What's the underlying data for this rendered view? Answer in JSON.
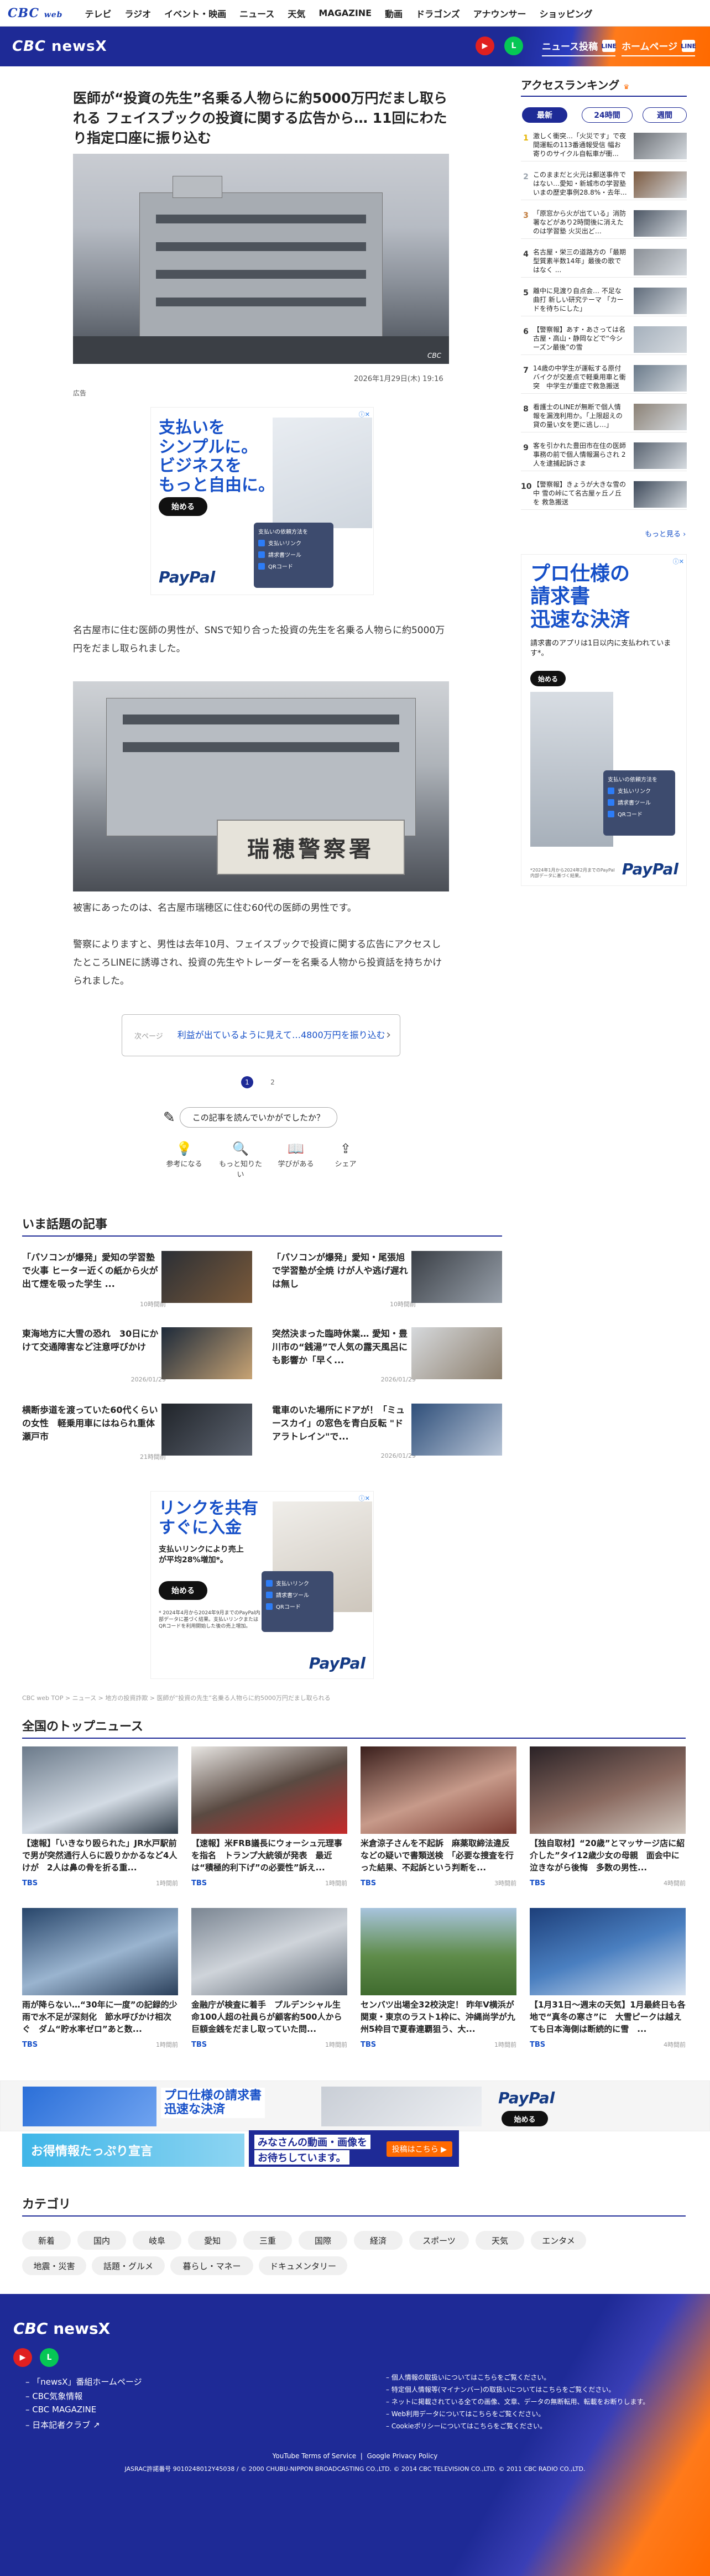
{
  "nav": {
    "logo": "CBC",
    "logo_sub": "web",
    "items": [
      "テレビ",
      "ラジオ",
      "イベント・映画",
      "ニュース",
      "天気",
      "MAGAZINE",
      "動画",
      "ドラゴンズ",
      "アナウンサー",
      "ショッピング"
    ]
  },
  "brand": {
    "name": "CBC",
    "sub": "newsX",
    "btn_post": "ニュース投稿",
    "btn_post_tag": "LINE",
    "btn_home": "ホームページ",
    "btn_home_tag": "LINE"
  },
  "article": {
    "title": "医師が“投資の先生”名乗る人物らに約5000万円だまし取られる フェイスブックの投資に関する広告から… 11回にわたり指定口座に振り込む",
    "photo_credit": "CBC",
    "date": "2026年1月29日(木) 19:16",
    "ad_label": "広告",
    "ad1": {
      "head": "支払いを\nシンプルに。\nビジネスを\nもっと自由に。",
      "cta": "始める",
      "brand": "PayPal",
      "ui_title": "支払いの依頼方法を",
      "ui_items": [
        "支払いリンク",
        "請求書ツール",
        "QRコード"
      ]
    },
    "p1": "名古屋市に住む医師の男性が、SNSで知り合った投資の先生を名乗る人物らに約5000万円をだまし取られました。",
    "sign": "瑞穂警察署",
    "p2": "被害にあったのは、名古屋市瑞穂区に住む60代の医師の男性です。",
    "p3": "警察によりますと、男性は去年10月、フェイスブックで投資に関する広告にアクセスしたところLINEに誘導され、投資の先生やトレーダーを名乗る人物から投資話を持ちかけられました。",
    "related_label": "次ページ",
    "related_text": "利益が出ているように見えて…4800万円を振り込む",
    "pages": [
      "1",
      "2"
    ],
    "feedback_q": "この記事を読んでいかがでしたか？",
    "reactions": [
      "参考になる",
      "もっと知りたい",
      "学びがある",
      "シェア"
    ]
  },
  "trending": {
    "heading": "いま話題の記事",
    "items": [
      {
        "title": "「パソコンが爆発」愛知の学習塾で火事 ヒーター近くの紙から火が出て煙を吸った学生 ...",
        "date": "10時間前"
      },
      {
        "title": "「パソコンが爆発」愛知・尾張旭で学習塾が全焼 けが人や逃げ遅れは無し",
        "date": "10時間前"
      },
      {
        "title": "東海地方に大雪の恐れ　30日にかけて交通障害など注意呼びかけ",
        "date": "2026/01/29"
      },
      {
        "title": "突然決まった臨時休業… 愛知・豊川市の“銭湯”で人気の露天風呂にも影響か「早く...",
        "date": "2026/01/29"
      },
      {
        "title": "横断歩道を渡っていた60代くらいの女性　軽乗用車にはねられ重体　瀬戸市",
        "date": "21時間前"
      },
      {
        "title": "電車のいた場所にドアが！「ミュースカイ」の窓色を青白反転 \"ドアラトレイン\"で...",
        "date": "2026/01/29"
      }
    ]
  },
  "ad2": {
    "head": "リンクを共有\nすぐに入金",
    "sub": "支払いリンクにより売上が平均28%増加*。",
    "cta": "始める",
    "brand": "PayPal",
    "note": "* 2024年4月から2024年9月までのPayPal内部データに基づく結果。支払いリンクまたはQRコードを利用開始した後の売上増加。",
    "ui_items": [
      "支払いリンク",
      "請求書ツール",
      "QRコード"
    ]
  },
  "breadcrumb": "CBC web TOP > ニュース > 地方の投資詐欺 > 医師が“投資の先生”名乗る人物らに約5000万円だまし取られる",
  "topnews": {
    "heading": "全国のトップニュース",
    "items": [
      {
        "title": "【速報】「いきなり殴られた」JR水戸駅前で男が突然通行人らに殴りかかるなど4人けが　2人は鼻の骨を折る重...",
        "src": "TBS",
        "ts": "1時間前"
      },
      {
        "title": "【速報】米FRB議長にウォーシュ元理事を指名　トランプ大統領が発表　最近は“積極的利下げ”の必要性”訴え...",
        "src": "TBS",
        "ts": "1時間前"
      },
      {
        "title": "米倉涼子さんを不起訴　麻薬取締法違反などの疑いで書類送検　「必要な捜査を行った結果、不起訴という判断を...",
        "src": "TBS",
        "ts": "3時間前"
      },
      {
        "title": "【独自取材】“20歳”とマッサージ店に紹介した”タイ12歳少女の母親　面会中に泣きながら後悔　多数の男性...",
        "src": "TBS",
        "ts": "4時間前"
      },
      {
        "title": "雨が降らない…“30年に一度”の記録的少雨で水不足が深刻化　節水呼びかけ相次ぐ　ダム“貯水率ゼロ”あと数...",
        "src": "TBS",
        "ts": "1時間前"
      },
      {
        "title": "金融庁が検査に着手　プルデンシャル生命100人超の社員らが顧客約500人から巨額金銭をだまし取っていた問...",
        "src": "TBS",
        "ts": "1時間前"
      },
      {
        "title": "センバツ出場全32校決定！ 昨年V横浜が関東・東京のラスト1枠に、沖縄尚学が九州5枠目で夏春連覇狙う、大...",
        "src": "TBS",
        "ts": "1時間前"
      },
      {
        "title": "【1月31日〜週末の天気】1月最終日も各地で“真冬の寒さ”に　大雪ピークは越えても日本海側は断続的に雪　...",
        "src": "TBS",
        "ts": "4時間前"
      }
    ]
  },
  "ad3": {
    "head": "プロ仕様の請求書\n迅速な決済",
    "brand": "PayPal",
    "cta": "始める"
  },
  "banner": {
    "left": "お得情報たっぷり宣言",
    "right_line1": "みなさんの動画・画像を",
    "right_line2": "お待ちしています。",
    "right_cta": "投稿はこちら ▶"
  },
  "categories": {
    "heading": "カテゴリ",
    "row1": [
      "新着",
      "国内",
      "岐阜",
      "愛知",
      "三重",
      "国際",
      "経済",
      "スポーツ",
      "天気",
      "エンタメ"
    ],
    "row2": [
      "地震・災害",
      "話題・グルメ",
      "暮らし・マネー",
      "ドキュメンタリー"
    ]
  },
  "side_ad": {
    "head": "プロ仕様の\n請求書\n迅速な決済",
    "sub": "請求書のアプリは1日以内に支払われています*。",
    "cta": "始める",
    "brand": "PayPal",
    "note": "*2024年1月から2024年2月までのPayPal内部データに基づく結果。",
    "ui_title": "支払いの依頼方法を",
    "ui_items": [
      "支払いリンク",
      "請求書ツール",
      "QRコード"
    ]
  },
  "ranking": {
    "heading": "アクセスランキング",
    "tabs": [
      "最新",
      "24時間",
      "週間"
    ],
    "more": "もっと見る",
    "items": [
      {
        "n": "1",
        "title": "激しく衝突…「火災です」で夜間運転の113番通報受信 幅お寄りのサイクル自転車が衝...",
        "color": "#e6b400"
      },
      {
        "n": "2",
        "title": "このままだと火元は郵送事件ではない…愛知・新城市の学習塾 いまの歴史事例28.8%・去年...",
        "color": "#9aa3ad"
      },
      {
        "n": "3",
        "title": "「原窓から火が出ている」消防署などがあり2時間後に消えたのは学習塾 火災出ど…",
        "color": "#c07a3b"
      },
      {
        "n": "4",
        "title": "名古屋・栄三の道路方の「最期型質素半数14年」最後の歌ではなく ...",
        "color": "#333"
      },
      {
        "n": "5",
        "title": "離中に見渡り自点会… 不足な曲打 新しい研究テーマ 「カードを待ちにした」",
        "color": "#333"
      },
      {
        "n": "6",
        "title": "【警察報】あす・あさっては名古屋・高山・静岡などで“今シーズン最後”の雪",
        "color": "#333"
      },
      {
        "n": "7",
        "title": "14歳の中学生が運転する原付バイクが交差点で軽乗用車と衝突　中学生が重症で救急搬送",
        "color": "#333"
      },
      {
        "n": "8",
        "title": "看護士のLINEが無断で個人情報を漏洩利用か。「上限超えの貸の量い女を更に逃し…」",
        "color": "#333"
      },
      {
        "n": "9",
        "title": "客を引かれた豊田市在住の医師 事務の前で個人情報漏らされ 2人を逮捕起訴さま",
        "color": "#333"
      },
      {
        "n": "10",
        "title": "【警察報】きょうが大きな雪の中 雪の峠にて名古屋ヶ丘ノ丘を 救急搬送",
        "color": "#333"
      }
    ]
  },
  "footer": {
    "brand": "CBC",
    "sub": "newsX",
    "links_left": [
      "「newsX」番組ホームページ",
      "CBC気象情報",
      "CBC MAGAZINE",
      "日本記者クラブ"
    ],
    "links_right": [
      "個人情報の取扱いについてはこちらをご覧ください。",
      "特定個人情報等(マイナンバー)の取扱いについてはこちらをご覧ください。",
      "ネットに掲載されている全ての画像、文章、データの無断転用、転載をお断りします。",
      "Web利用データについてはこちらをご覧ください。",
      "Cookieポリシーについてはこちらをご覧ください。"
    ],
    "legal1": "YouTube Terms of Service",
    "legal2": "Google Privacy Policy",
    "copyright": "JASRAC許諾番号 9010248012Y45038 / © 2000 CHUBU-NIPPON BROADCASTING CO.,LTD. © 2014 CBC TELEVISION CO.,LTD. © 2011 CBC RADIO CO.,LTD."
  },
  "colors": {
    "brand": "#1e2a96",
    "accent": "#ff6a00",
    "link": "#1650c8"
  }
}
